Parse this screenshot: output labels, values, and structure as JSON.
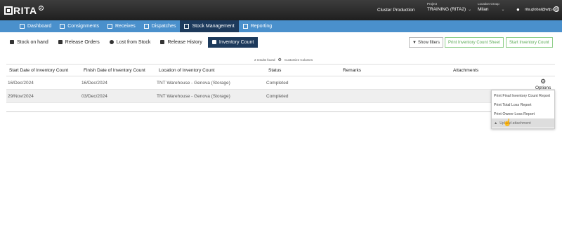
{
  "app": {
    "logo": "RITA",
    "logo_sup": "2"
  },
  "topbar": {
    "cluster": "Cluster Production",
    "project_label": "Project",
    "project": "TRAINING (RITA2)",
    "location_label": "Location Group",
    "location": "Milan",
    "user": "rita.global@wfp.org",
    "help": "?"
  },
  "nav": {
    "tabs": [
      {
        "label": "Dashboard"
      },
      {
        "label": "Consignments"
      },
      {
        "label": "Receives"
      },
      {
        "label": "Dispatches"
      },
      {
        "label": "Stock Management"
      },
      {
        "label": "Reporting"
      }
    ]
  },
  "subnav": {
    "tabs": [
      {
        "label": "Stock on hand"
      },
      {
        "label": "Release Orders"
      },
      {
        "label": "Lost from Stock"
      },
      {
        "label": "Release History"
      },
      {
        "label": "Inventory Count"
      }
    ],
    "show_filters": "Show filters",
    "print_sheet": "Print Inventory Count Sheet",
    "start_count": "Start Inventory Count"
  },
  "results": {
    "count_text": "2 results found",
    "customize": "Customize Columns"
  },
  "table": {
    "headers": [
      "Start Date of Inventory Count",
      "Finish Date of Inventory Count",
      "Location of Inventory Count",
      "Status",
      "Remarks",
      "Attachments"
    ],
    "rows": [
      {
        "start": "16/Dec/2024",
        "finish": "16/Dec/2024",
        "location": "TNT Warehouse - Genova (Storage)",
        "status": "Completed"
      },
      {
        "start": "29/Nov/2024",
        "finish": "03/Dec/2024",
        "location": "TNT Warehouse - Genova (Storage)",
        "status": "Completed"
      }
    ],
    "options_label": "Options"
  },
  "menu": {
    "items": [
      {
        "label": "Print Final Inventory Count Report"
      },
      {
        "label": "Print Total Loss Report"
      },
      {
        "label": "Print Owner Loss Report"
      },
      {
        "label": "Upload attachment"
      }
    ]
  },
  "colors": {
    "nav_bg": "#4a90cc",
    "active_tab": "#1d3a5c",
    "topbar": "#2b2b2b",
    "green": "#5aaa55"
  }
}
